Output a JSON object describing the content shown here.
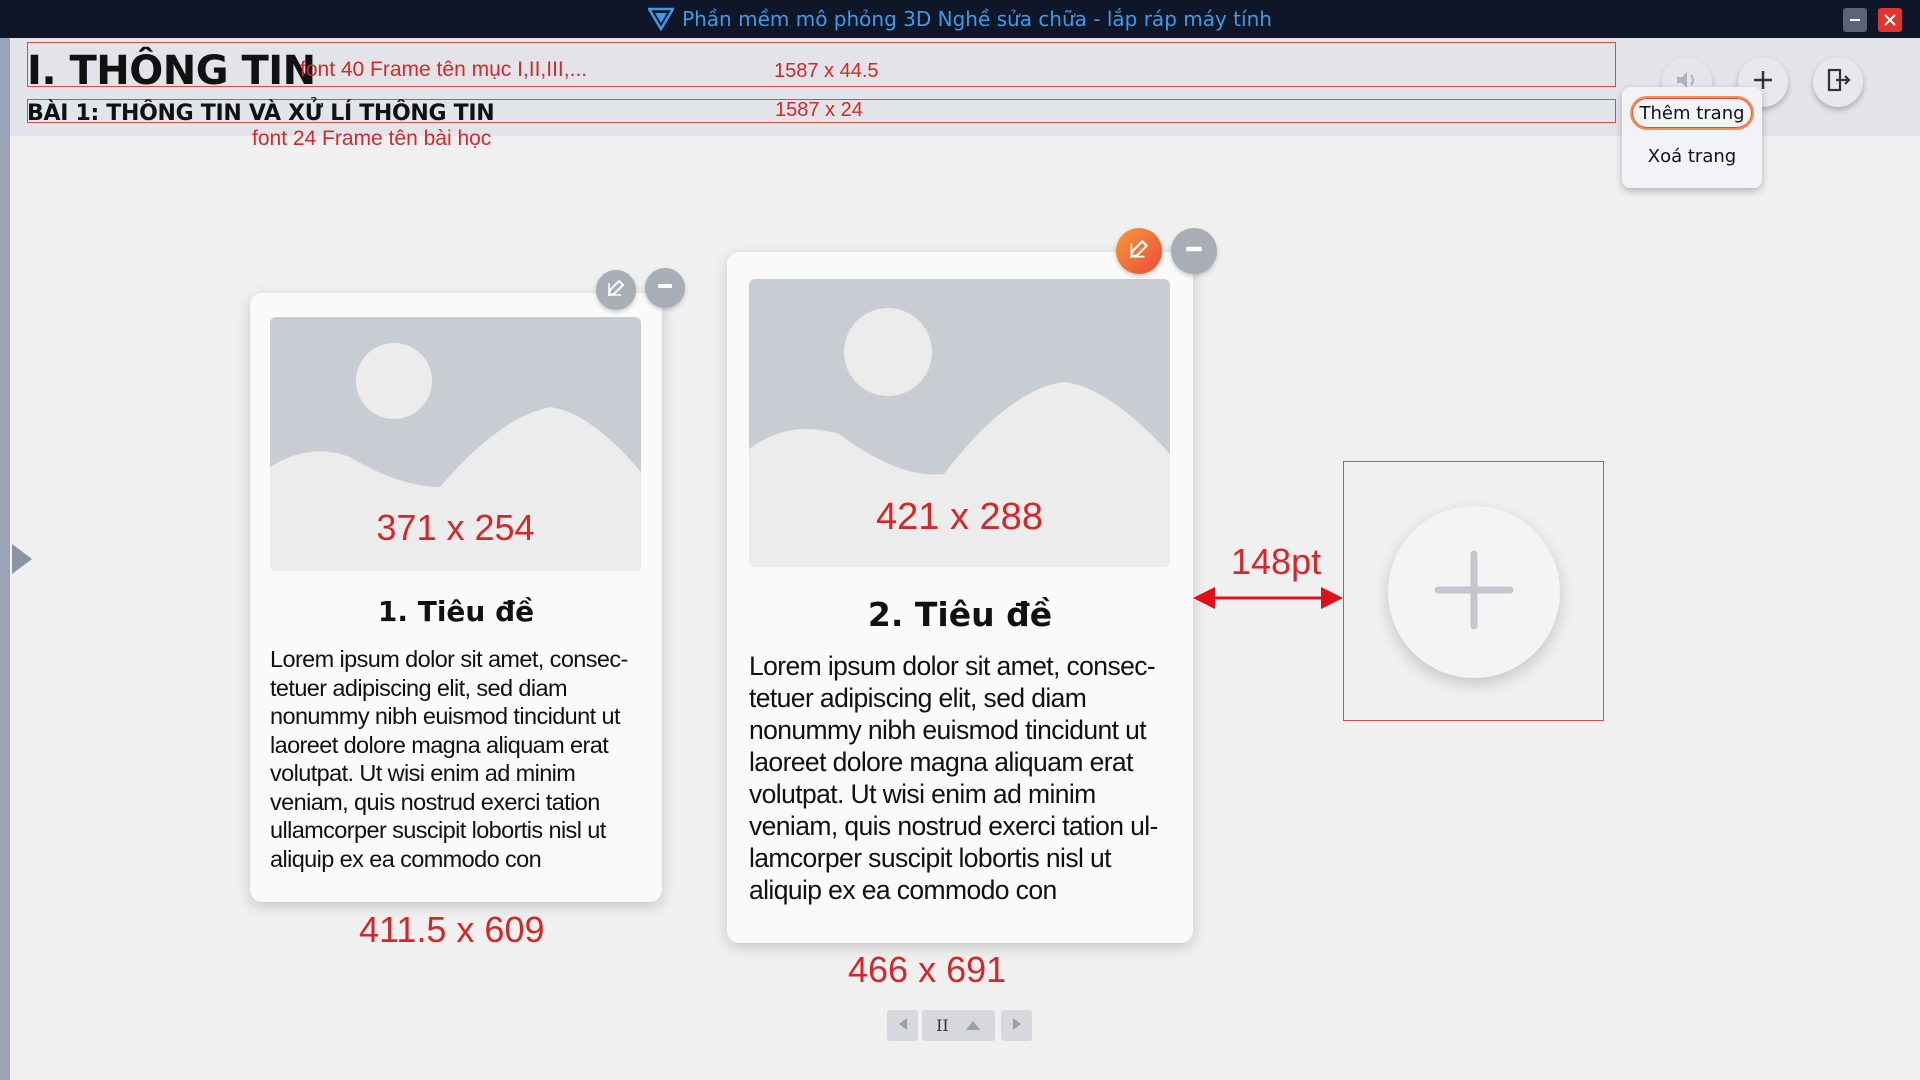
{
  "window": {
    "title": "Phần mềm mô phỏng 3D Nghề sửa chữa - lắp ráp máy tính"
  },
  "header": {
    "section_title": "I. THÔNG TIN",
    "lesson_title": "BÀI 1: THÔNG TIN VÀ XỬ LÍ THÔNG TIN"
  },
  "annotations": {
    "section_font_note": "font 40  Frame tên mục I,II,III,...",
    "section_frame_size": "1587 x 44.5",
    "lesson_frame_size": "1587 x 24",
    "lesson_font_note": "font 24  Frame tên bài học",
    "spacing": "148pt"
  },
  "toolbar": {
    "sound_icon": "sound-icon",
    "add_icon": "plus-icon",
    "exit_icon": "exit-icon"
  },
  "page_menu": {
    "add_page": "Thêm trang",
    "delete_page": "Xoá trang"
  },
  "cards": [
    {
      "image_size": "371 x 254",
      "title": "1. Tiêu đề",
      "body": "Lorem ipsum dolor sit amet, consec-tetuer adipiscing elit, sed diam nonummy nibh euismod tincidunt ut laoreet dolore magna aliquam erat volutpat. Ut wisi enim ad minim veniam, quis nostrud exerci tation ullamcorper suscipit lobortis nisl ut aliquip ex ea commodo con",
      "card_size": "411.5 x 609"
    },
    {
      "image_size": "421 x 288",
      "title": "2. Tiêu đề",
      "body": "Lorem ipsum dolor sit amet, consec-tetuer adipiscing elit, sed diam nonummy nibh euismod tincidunt ut laoreet dolore magna aliquam erat volutpat. Ut wisi enim ad minim veniam, quis nostrud exerci tation ul-lamcorper suscipit lobortis nisl ut aliquip ex ea commodo con",
      "card_size": "466 x 691"
    }
  ],
  "pager": {
    "current_label": "II"
  },
  "colors": {
    "titlebar_bg": "#0f1628",
    "title_text": "#3d9be8",
    "annotation_red": "#d42828",
    "edit_active_orange": "#f0944a"
  }
}
